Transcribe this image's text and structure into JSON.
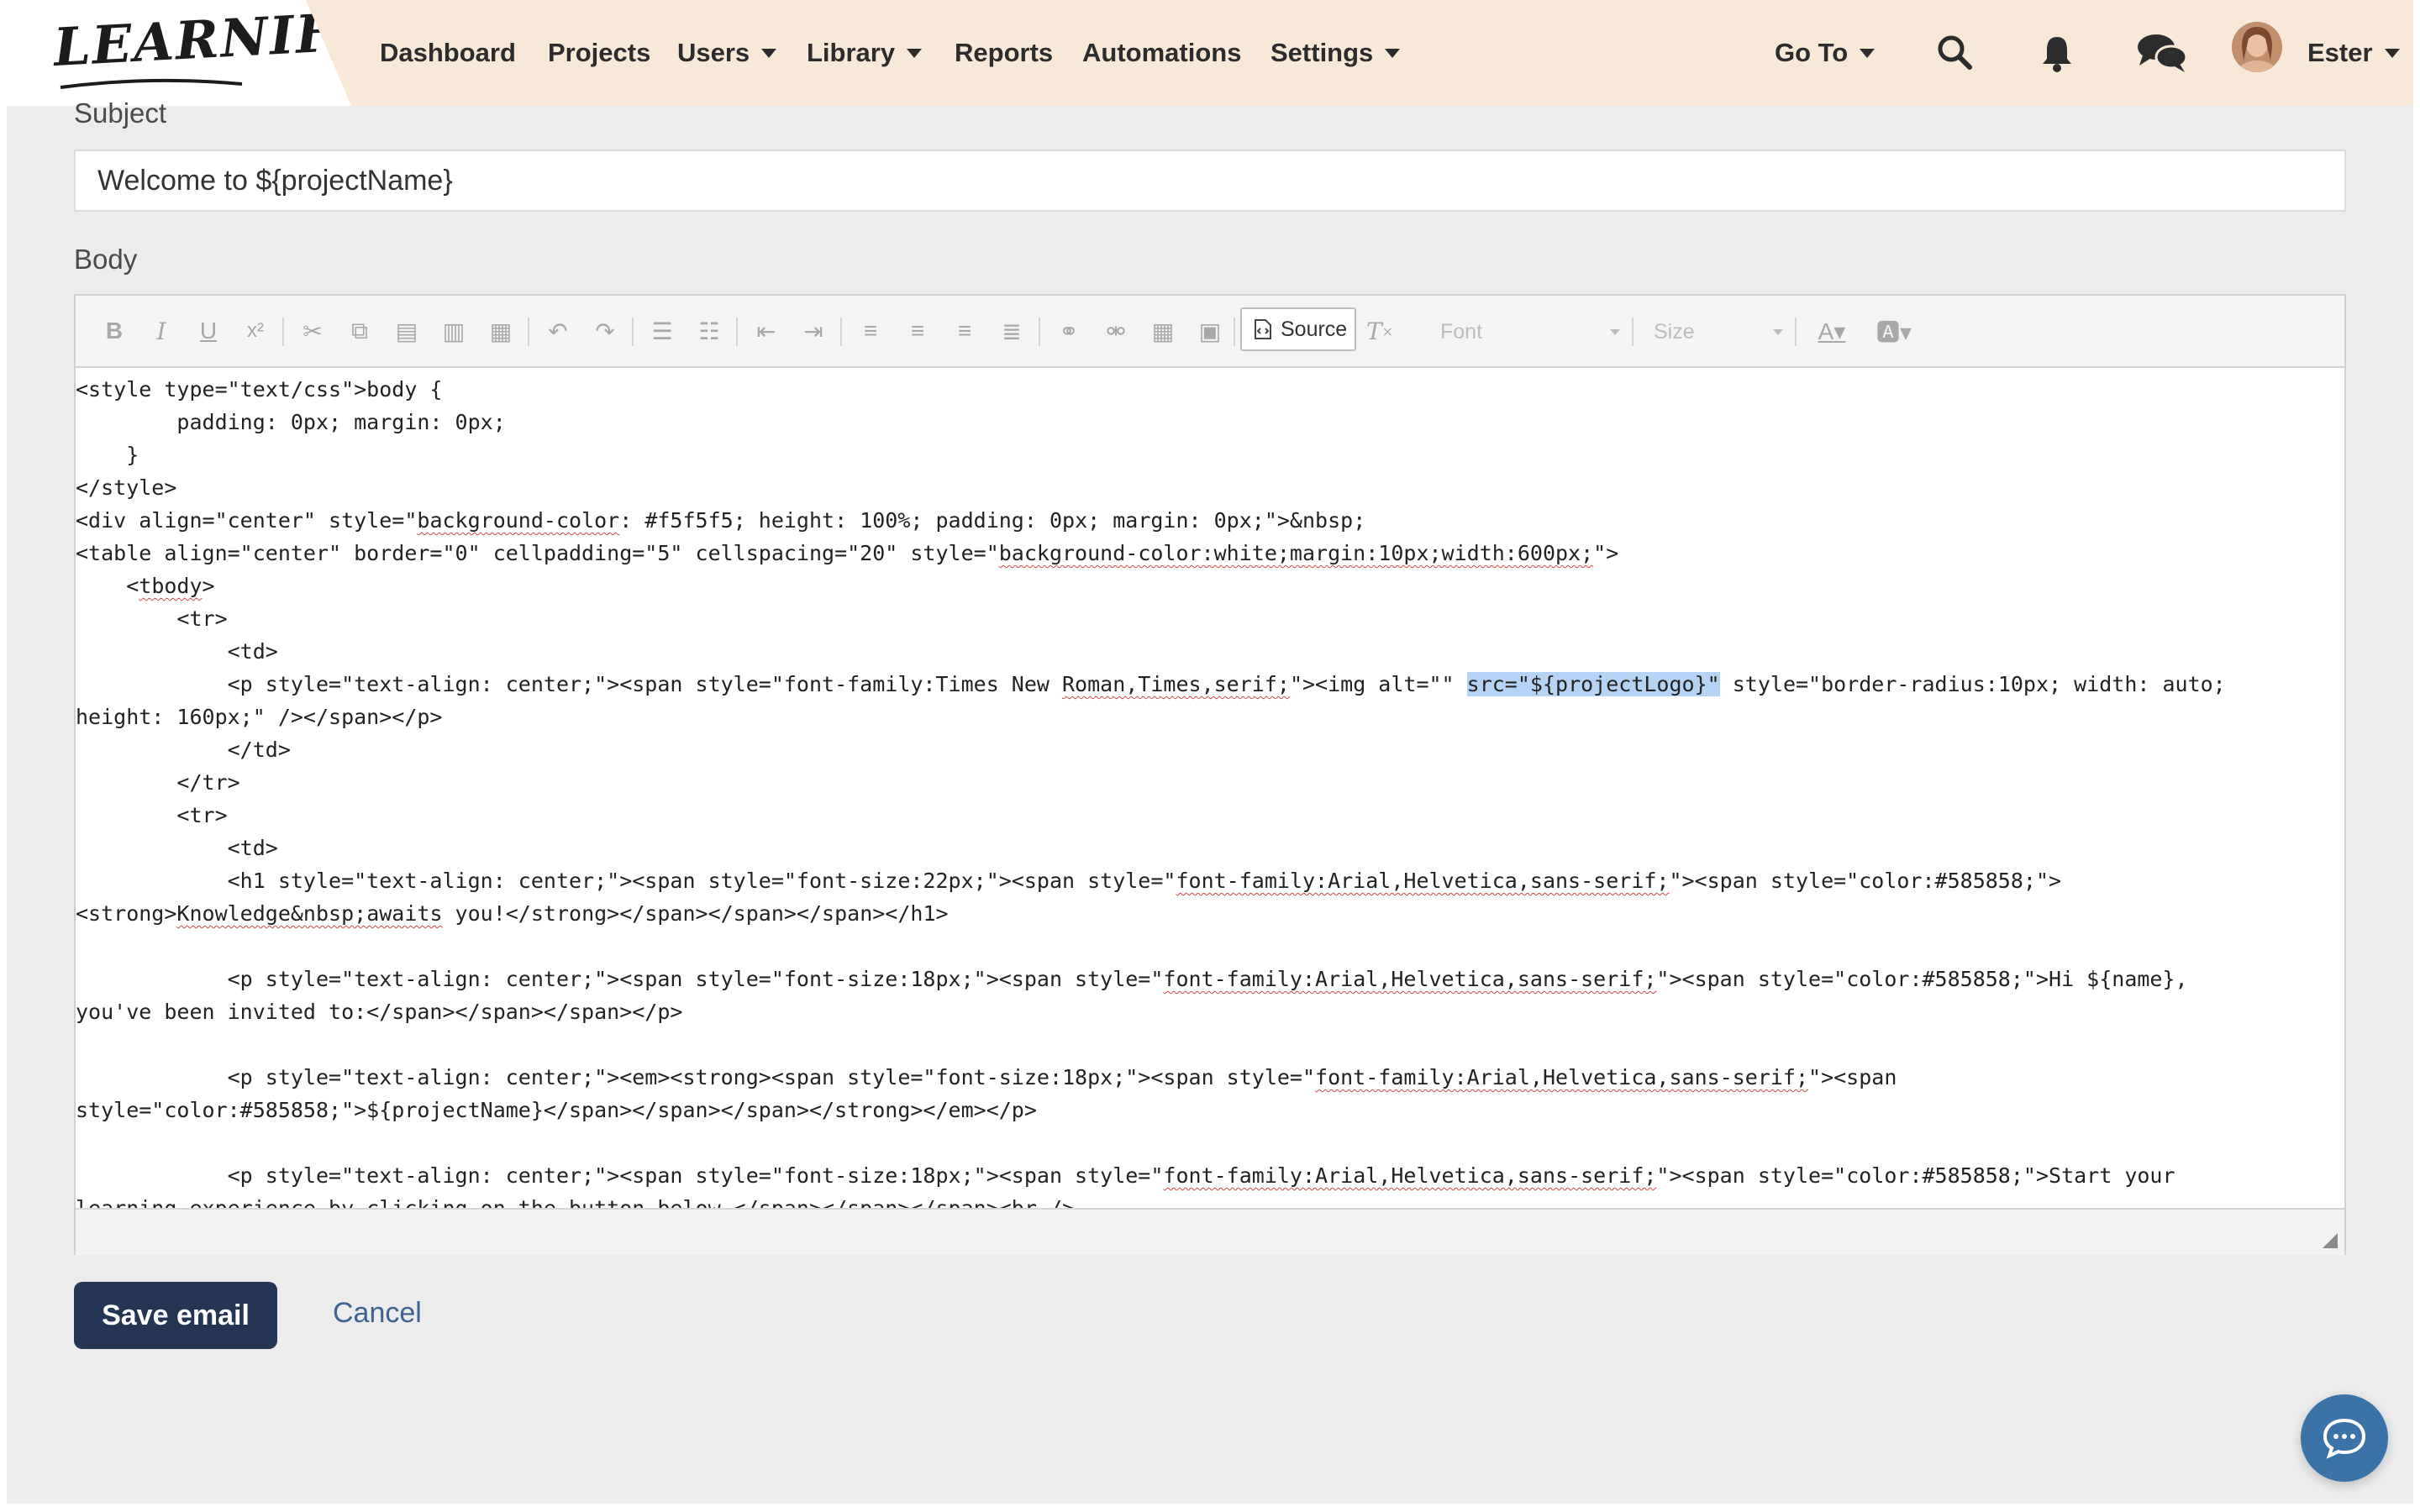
{
  "brand": {
    "logo_text": "LEARNIFIER"
  },
  "nav": {
    "items": [
      {
        "label": "Dashboard",
        "dropdown": false
      },
      {
        "label": "Projects",
        "dropdown": false
      },
      {
        "label": "Users",
        "dropdown": true
      },
      {
        "label": "Library",
        "dropdown": true
      },
      {
        "label": "Reports",
        "dropdown": false
      },
      {
        "label": "Automations",
        "dropdown": false
      },
      {
        "label": "Settings",
        "dropdown": true
      }
    ],
    "goto_label": "Go To",
    "user_name": "Ester",
    "icons": [
      "search-icon",
      "bell-icon",
      "chat-bubbles-icon"
    ]
  },
  "form": {
    "subject_label": "Subject",
    "subject_value": "Welcome to ${projectName}",
    "body_label": "Body"
  },
  "toolbar": {
    "source_label": "Source",
    "font_placeholder": "Font",
    "size_placeholder": "Size",
    "icons": [
      "bold-icon",
      "italic-icon",
      "underline-icon",
      "superscript-icon",
      "cut-icon",
      "copy-icon",
      "paste-icon",
      "paste-text-icon",
      "paste-word-icon",
      "undo-icon",
      "redo-icon",
      "numbered-list-icon",
      "bulleted-list-icon",
      "outdent-icon",
      "indent-icon",
      "align-left-icon",
      "align-center-icon",
      "align-right-icon",
      "justify-icon",
      "link-icon",
      "unlink-icon",
      "table-icon",
      "image-icon",
      "source-icon",
      "remove-format-icon",
      "text-color-icon",
      "background-color-icon"
    ]
  },
  "source_code": {
    "lines": [
      "<style type=\"text/css\">body {",
      "        padding: 0px; margin: 0px;",
      "    }",
      "</style>",
      "<div align=\"center\" style=\"background-color: #f5f5f5; height: 100%; padding: 0px; margin: 0px;\">&nbsp;",
      "<table align=\"center\" border=\"0\" cellpadding=\"5\" cellspacing=\"20\" style=\"background-color:white;margin:10px;width:600px;\">",
      "    <tbody>",
      "        <tr>",
      "            <td>",
      "            <p style=\"text-align: center;\"><span style=\"font-family:Times New Roman,Times,serif;\"><img alt=\"\" src=\"${projectLogo}\" style=\"border-radius:10px; width: auto;",
      "height: 160px;\" /></span></p>",
      "            </td>",
      "        </tr>",
      "        <tr>",
      "            <td>",
      "            <h1 style=\"text-align: center;\"><span style=\"font-size:22px;\"><span style=\"font-family:Arial,Helvetica,sans-serif;\"><span style=\"color:#585858;\">",
      "<strong>Knowledge&nbsp;awaits you!</strong></span></span></span></h1>",
      "",
      "            <p style=\"text-align: center;\"><span style=\"font-size:18px;\"><span style=\"font-family:Arial,Helvetica,sans-serif;\"><span style=\"color:#585858;\">Hi ${name},",
      "you've been invited to:</span></span></span></p>",
      "",
      "            <p style=\"text-align: center;\"><em><strong><span style=\"font-size:18px;\"><span style=\"font-family:Arial,Helvetica,sans-serif;\"><span",
      "style=\"color:#585858;\">${projectName}</span></span></span></strong></em></p>",
      "",
      "            <p style=\"text-align: center;\"><span style=\"font-size:18px;\"><span style=\"font-family:Arial,Helvetica,sans-serif;\"><span style=\"color:#585858;\">Start your",
      "learning experience by clicking on the button below.</span></span></span><br />"
    ],
    "selected_text": "src=\"${projectLogo}\"",
    "spellcheck_words": [
      "background-color",
      "background-color:white;margin:10px;width:600px;",
      "tbody",
      "Roman,Times,serif;",
      "font-family:Arial,Helvetica,sans-serif;",
      "Knowledge&nbsp;awaits"
    ]
  },
  "actions": {
    "save_label": "Save email",
    "cancel_label": "Cancel"
  },
  "colors": {
    "nav_bg": "#f7e8d8",
    "primary_button": "#243654",
    "link": "#3e6390",
    "chat_fab": "#3b73a8",
    "selection": "#b5d3f5"
  }
}
